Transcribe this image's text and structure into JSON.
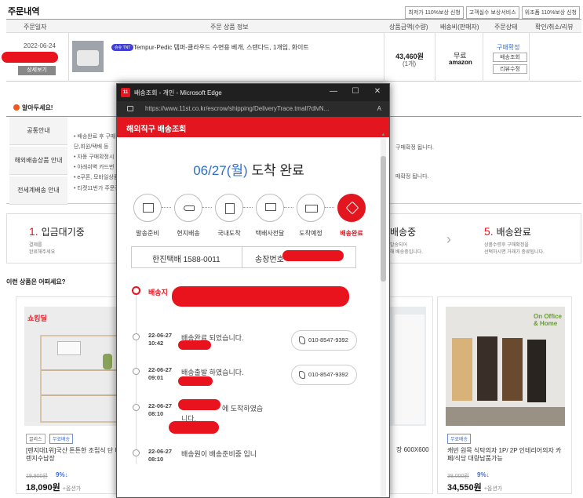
{
  "order": {
    "title": "주문내역",
    "top_buttons": [
      "최저가 110%보상 신청",
      "고객실수 보상서비스",
      "위조품 110%보상 신청"
    ],
    "columns": [
      "주문일자",
      "주문 상품 정보",
      "상품금액(수량)",
      "배송비(판매자)",
      "주문상태",
      "확인/취소/리뷰"
    ],
    "date": "2022-06-24",
    "detail_button": "상세보기",
    "badge": "슈슈 TNT",
    "product_name": "Tempur-Pedic 템퍼-클라우드 수면용 베개, 스탠다드, 1개입, 화이트",
    "price": "43,460원",
    "qty": "(1개)",
    "shipping": "무료",
    "seller": "amazon",
    "status_link": "구매확정",
    "status_buttons": [
      "배송조회",
      "리뷰수정"
    ]
  },
  "notice": {
    "title": "알아두세요!",
    "sides": [
      "공통안내",
      "해외배송상품 안내",
      "전세계배송 안내"
    ],
    "lines": [
      "• 배송완료 후 구매",
      "단,회원/택배 등",
      "• 자동 구매확정시",
      "• 아래쉬벽 카드번",
      "• e쿠폰, 모바일상품",
      "• 티켓11번가 주문건"
    ],
    "right_lines": [
      "구매확정 됩니다.",
      "매확정 됩니다."
    ]
  },
  "steps": [
    {
      "num": "1.",
      "label": "입금대기중",
      "desc": [
        "결제를",
        "완료해주세요"
      ]
    },
    {
      "num": "",
      "label": "배송중",
      "desc": [
        "발송되어",
        "해 배송중입니다."
      ]
    },
    {
      "num": "5.",
      "label": "배송완료",
      "desc": [
        "상품수령후 구매확정을",
        "선택하시면 거래가 종료됩니다."
      ]
    }
  ],
  "reco": {
    "title": "이런 상품은 어떠세요?",
    "cards": [
      {
        "brand": "쇼킹딜",
        "chips": [
          "끌리스",
          "무료배송"
        ],
        "name": "[렌지대1위]국산 튼튼한 조립식 단 다이 전자렌지수납장",
        "old": "19,900원",
        "disc": "9%↓",
        "price": "18,090원",
        "opt": "+옵션가"
      },
      {
        "name": "장 600X600"
      },
      {
        "brand": "On Office & Home",
        "chips": [
          "무료배송"
        ],
        "name": "캐빈 원목 식탁의자 1P/ 2P 인테리어의자 카페/식당 대량납품가능",
        "old": "38,000원",
        "disc": "9%↓",
        "price": "34,550원",
        "opt": "+옵션가"
      }
    ]
  },
  "popup": {
    "window_title": "배송조회 - 개인 - Microsoft Edge",
    "app_icon": "11",
    "url": "https://www.11st.co.kr/escrow/shipping/DeliveryTrace.tmall?dlvN...",
    "aa_label": "A",
    "header": "해외직구 배송조회",
    "arrive_date": "06/27(월)",
    "arrive_text": "도착 완료",
    "track_steps": [
      "발송준비",
      "현지배송",
      "국내도착",
      "택배사전달",
      "도착예정",
      "배송완료"
    ],
    "active_step": 5,
    "courier": "한진택배 1588-0011",
    "invoice_label": "송장번호",
    "dest_label": "배송지",
    "events": [
      {
        "date": "22-06-27",
        "time": "10:42",
        "text": "배송완료 되었습니다.",
        "phone": "010-8547-9392"
      },
      {
        "date": "22-06-27",
        "time": "09:01",
        "text": "배송출발 하였습니다.",
        "phone": "010-8547-9392"
      },
      {
        "date": "22-06-27",
        "time": "08:10",
        "text": "에 도착하였습",
        "text2": "니다."
      },
      {
        "date": "22-06-27",
        "time": "08:10",
        "text": "배송원이 배송준비중 입니"
      }
    ],
    "colors": {
      "accent": "#e3161f",
      "date_blue": "#2e6fc9"
    }
  }
}
